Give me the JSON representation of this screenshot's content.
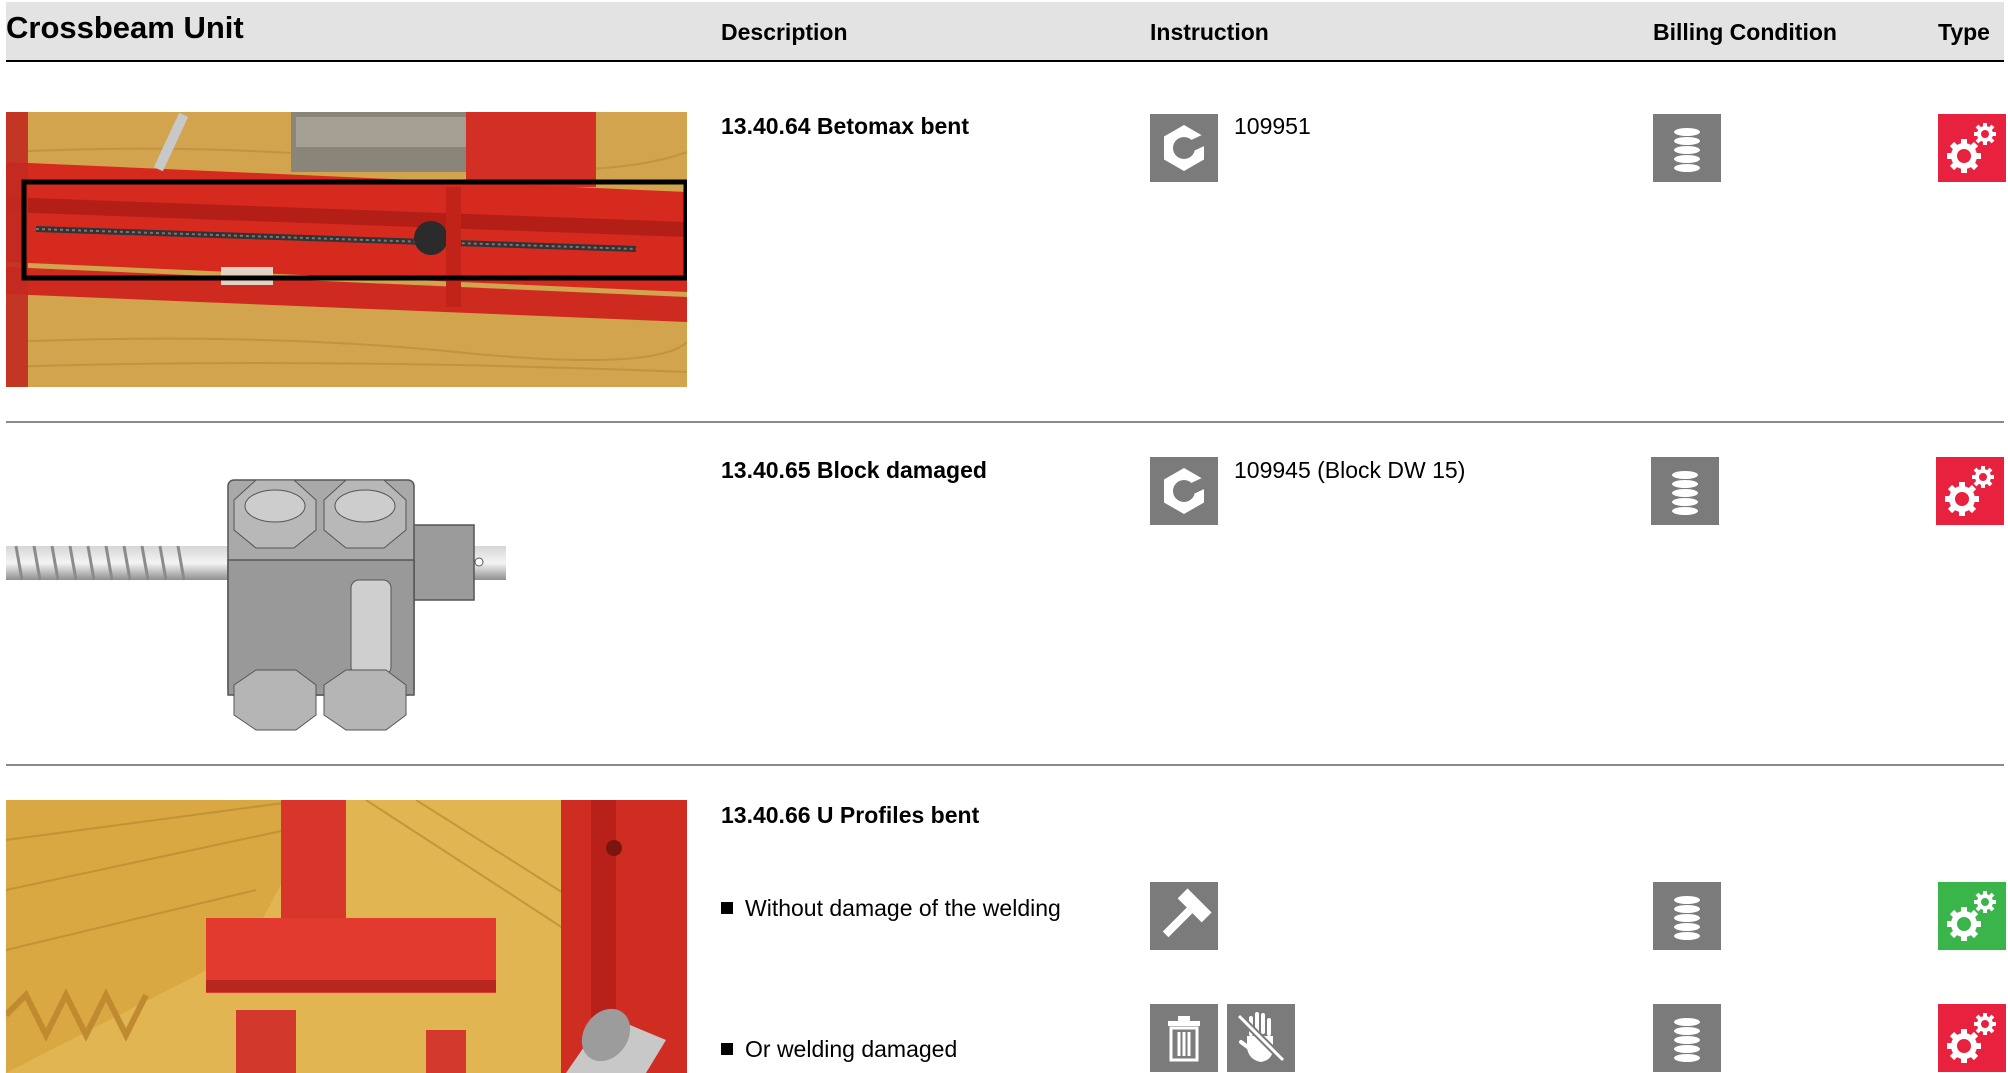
{
  "header": {
    "title": "Crossbeam Unit",
    "col_description": "Description",
    "col_instruction": "Instruction",
    "col_billing": "Billing Condition",
    "col_type": "Type"
  },
  "colors": {
    "header_bg": "#e3e3e3",
    "icon_grey": "#7b7b7b",
    "type_red": "#e8213f",
    "type_green": "#3ab54a"
  },
  "rows": [
    {
      "description": "13.40.64 Betomax bent",
      "instruction_icon": "nut-icon",
      "instruction_text": "109951",
      "billing_icon": "stack-icon",
      "type_icon": "gears-icon",
      "type_color": "red"
    },
    {
      "description": "13.40.65 Block damaged",
      "instruction_icon": "nut-icon",
      "instruction_text": "109945 (Block DW 15)",
      "billing_icon": "stack-icon",
      "type_icon": "gears-icon",
      "type_color": "red"
    },
    {
      "description": "13.40.66 U Profiles bent",
      "subitems": [
        {
          "text": "Without damage of the welding",
          "instruction_icons": [
            "hammer-icon"
          ],
          "billing_icon": "stack-icon",
          "type_icon": "gears-icon",
          "type_color": "green"
        },
        {
          "text": "Or welding damaged",
          "instruction_icons": [
            "trash-icon",
            "no-hand-icon"
          ],
          "billing_icon": "stack-icon",
          "type_icon": "gears-icon",
          "type_color": "red"
        }
      ]
    }
  ]
}
